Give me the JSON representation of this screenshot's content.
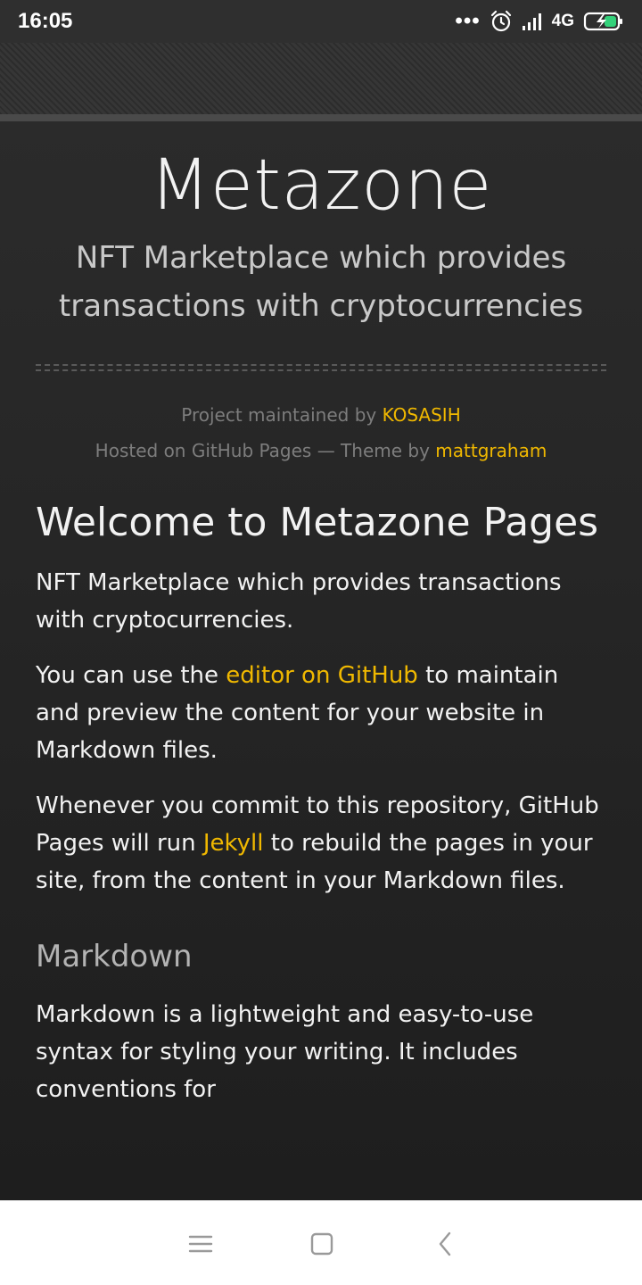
{
  "status_bar": {
    "time": "16:05",
    "dots": "•••",
    "network": "4G",
    "icons": [
      "alarm-icon",
      "signal-icon",
      "battery-charging-icon"
    ]
  },
  "header": {
    "title": "Metazone",
    "tagline": "NFT Marketplace which provides transactions with cryptocurrencies"
  },
  "credits": {
    "maintained_prefix": "Project maintained by",
    "maintainer": "KOSASIH",
    "hosted_prefix": "Hosted on GitHub Pages — Theme by",
    "theme_author": "mattgraham"
  },
  "main": {
    "heading": "Welcome to Metazone Pages",
    "intro": "NFT Marketplace which provides transactions with cryptocurrencies.",
    "p2_before": "You can use the ",
    "p2_link": "editor on GitHub",
    "p2_after": " to maintain and preview the content for your website in Markdown files.",
    "p3_before": "Whenever you commit to this repository, GitHub Pages will run ",
    "p3_link": "Jekyll",
    "p3_after": " to rebuild the pages in your site, from the content in your Markdown files.",
    "subheading": "Markdown",
    "p4": "Markdown is a lightweight and easy-to-use syntax for styling your writing. It includes conventions for"
  },
  "colors": {
    "background": "#212121",
    "text": "#f2f2f2",
    "link": "#f0b800",
    "muted": "#7d7d7d"
  },
  "nav_bar": {
    "icons": [
      "menu-icon",
      "home-icon",
      "back-icon"
    ]
  }
}
